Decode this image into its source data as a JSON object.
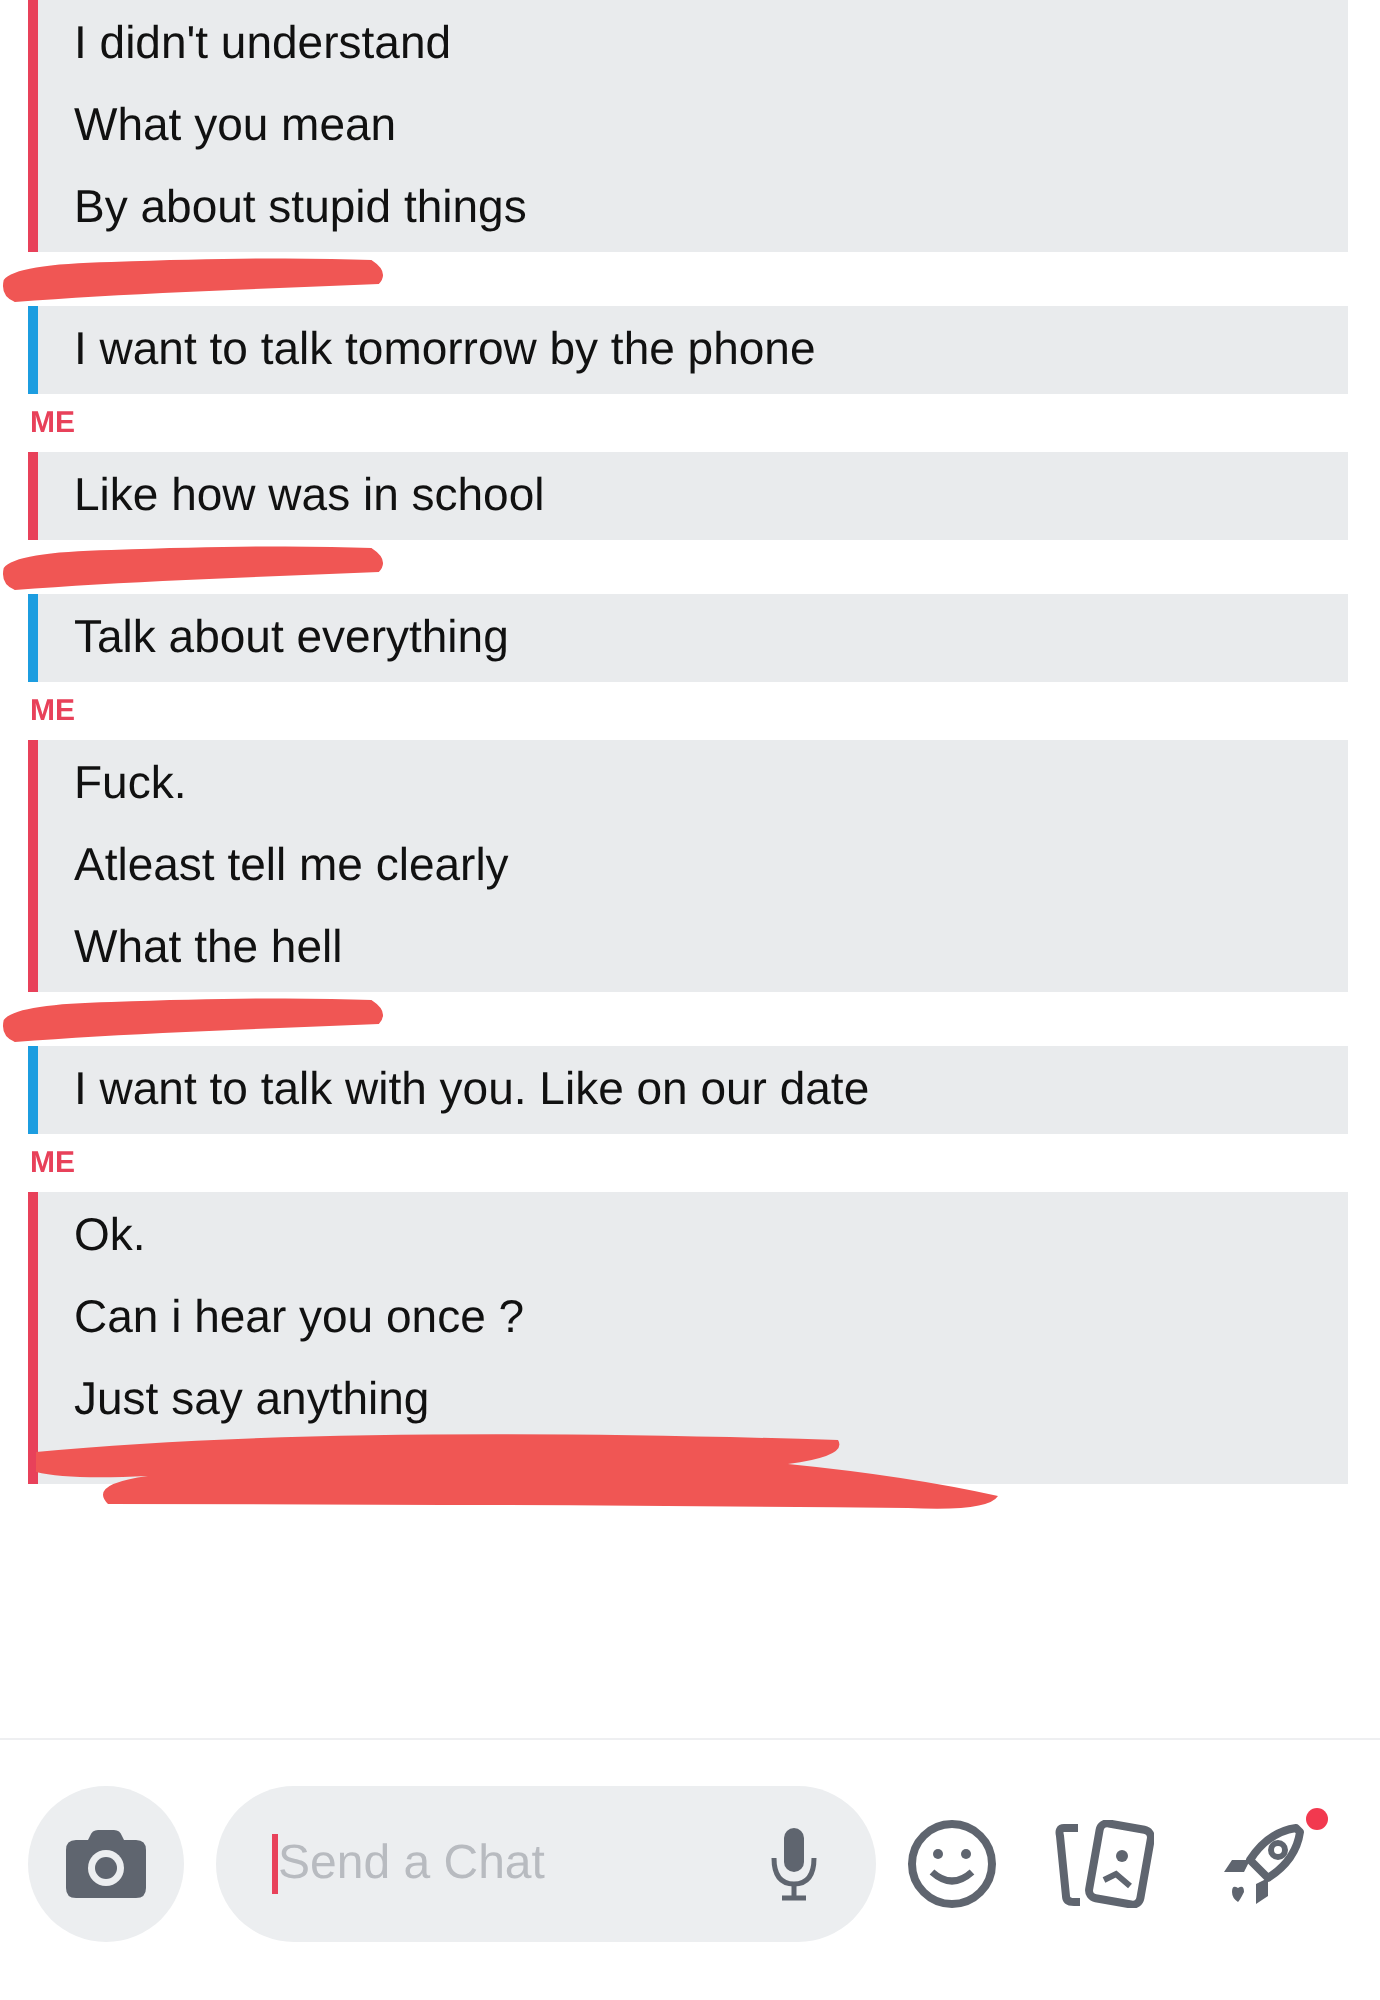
{
  "chat": [
    {
      "kind": "message",
      "color": "#e8415a",
      "lines": [
        "I didn't understand",
        "What you mean",
        "By about stupid things"
      ],
      "redacted_tail": false
    },
    {
      "kind": "redaction"
    },
    {
      "kind": "message",
      "color": "#1c9de0",
      "lines": [
        "I want to talk tomorrow by the phone"
      ],
      "redacted_tail": false
    },
    {
      "kind": "label",
      "text": "ME",
      "color": "#e8415a"
    },
    {
      "kind": "message",
      "color": "#e8415a",
      "lines": [
        "Like how was in school"
      ],
      "redacted_tail": false
    },
    {
      "kind": "redaction"
    },
    {
      "kind": "message",
      "color": "#1c9de0",
      "lines": [
        "Talk about everything"
      ],
      "redacted_tail": false
    },
    {
      "kind": "label",
      "text": "ME",
      "color": "#e8415a"
    },
    {
      "kind": "message",
      "color": "#e8415a",
      "lines": [
        "Fuck.",
        "Atleast tell me clearly",
        "What the hell"
      ],
      "redacted_tail": false
    },
    {
      "kind": "redaction"
    },
    {
      "kind": "message",
      "color": "#1c9de0",
      "lines": [
        "I want to talk with you. Like on our date"
      ],
      "redacted_tail": false
    },
    {
      "kind": "label",
      "text": "ME",
      "color": "#e8415a"
    },
    {
      "kind": "message",
      "color": "#e8415a",
      "lines": [
        "Ok.",
        "Can i hear you once ?",
        "Just say anything"
      ],
      "redacted_tail": true
    }
  ],
  "composer": {
    "placeholder": "Send a Chat",
    "notification": true
  }
}
